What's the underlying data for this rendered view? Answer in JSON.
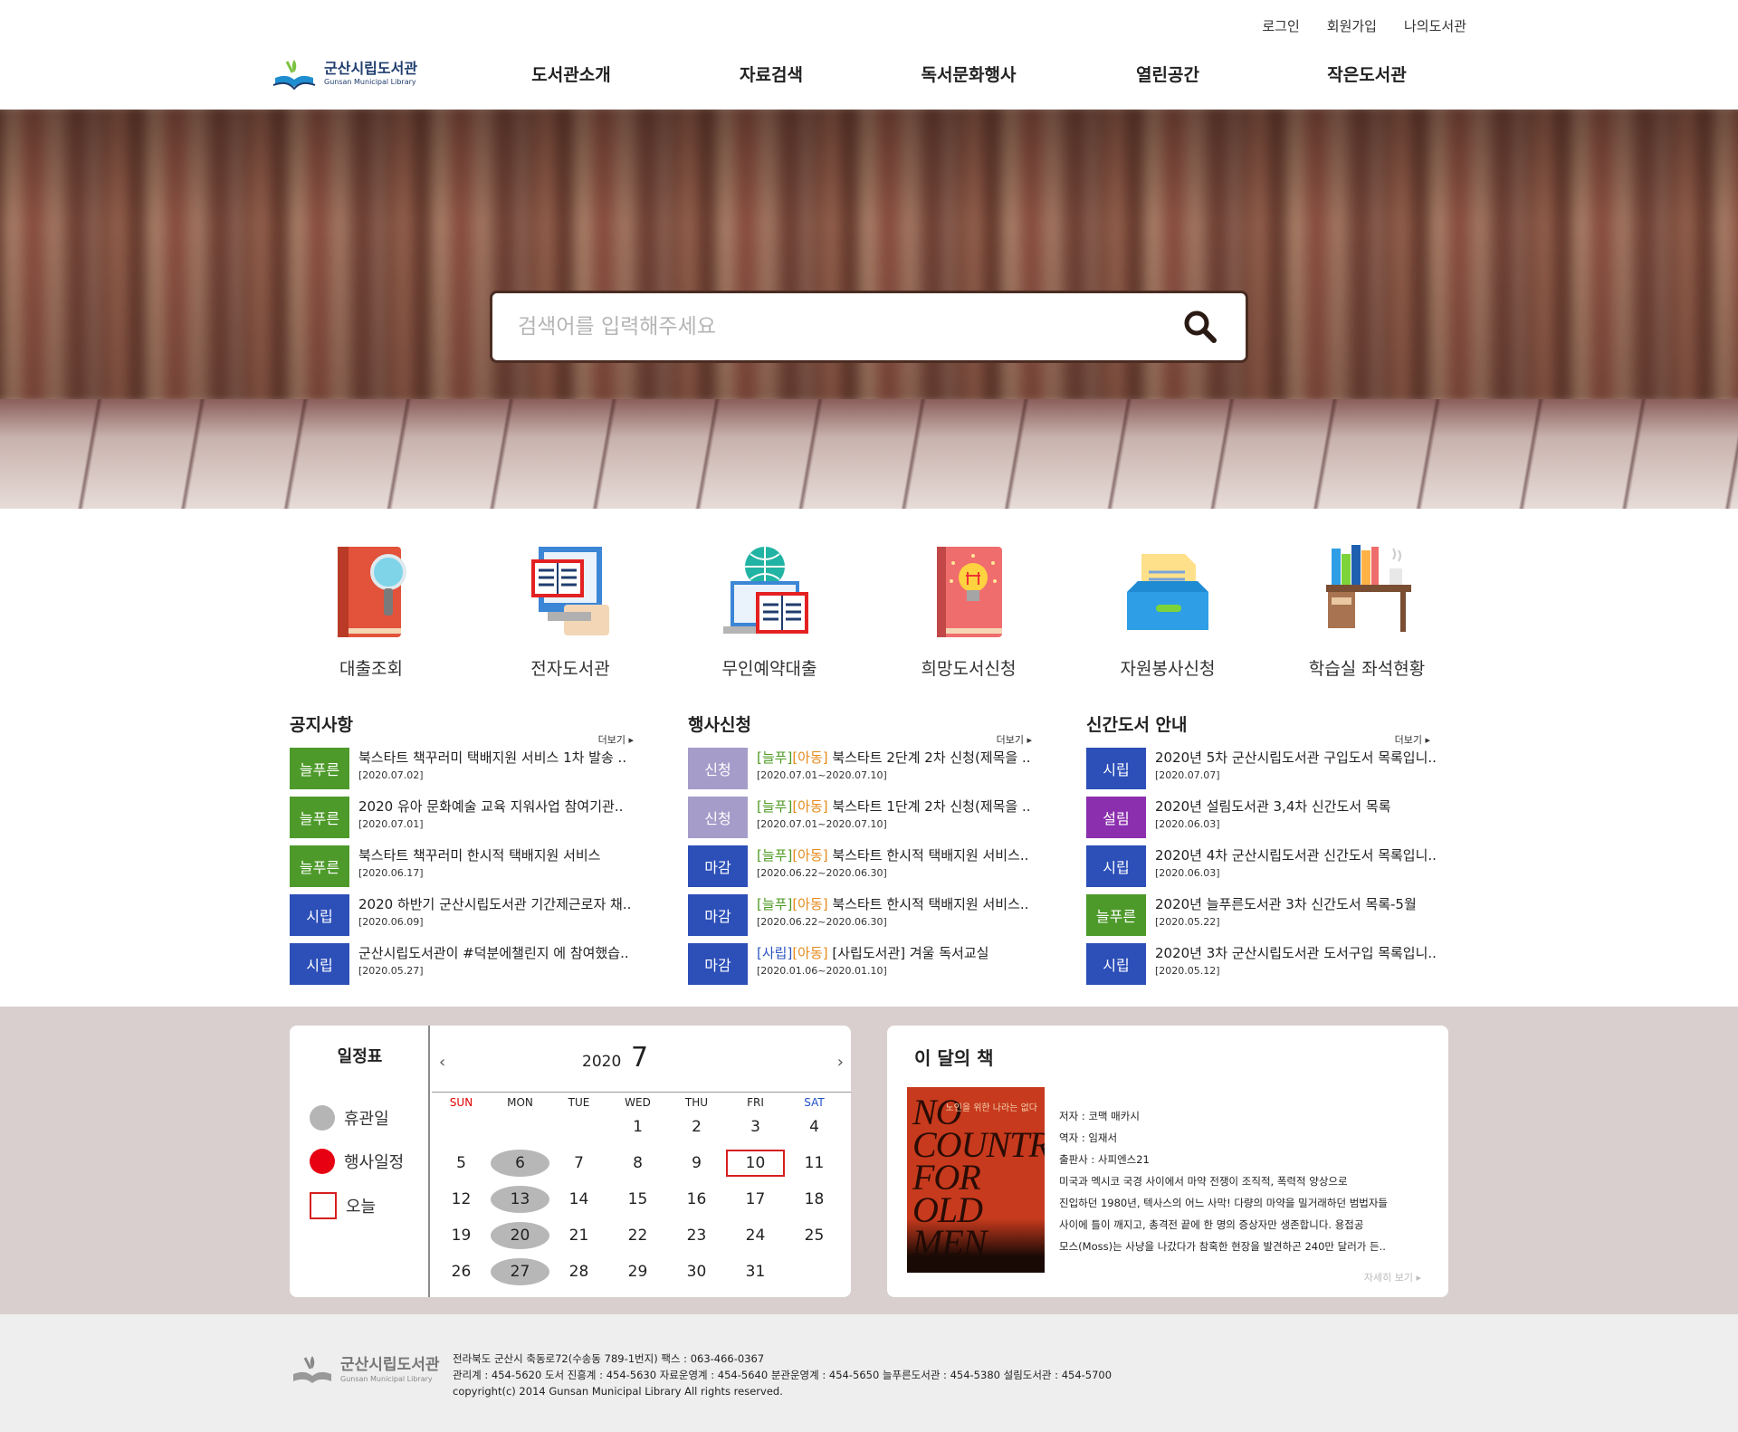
{
  "header": {
    "top_links": [
      "로그인",
      "회원가입",
      "나의도서관"
    ],
    "logo_ko": "군산시립도서관",
    "logo_en": "Gunsan Municipal Library",
    "nav": [
      "도서관소개",
      "자료검색",
      "독서문화행사",
      "열린공간",
      "작은도서관"
    ]
  },
  "search": {
    "placeholder": "검색어를 입력해주세요",
    "icon": "search-icon"
  },
  "quick_menu": [
    {
      "label": "대출조회",
      "icon": "book-magnifier-icon"
    },
    {
      "label": "전자도서관",
      "icon": "e-library-icon"
    },
    {
      "label": "무인예약대출",
      "icon": "globe-laptop-icon"
    },
    {
      "label": "희망도서신청",
      "icon": "lightbulb-book-icon"
    },
    {
      "label": "자원봉사신청",
      "icon": "document-tray-icon"
    },
    {
      "label": "학습실 좌석현황",
      "icon": "desk-books-icon"
    }
  ],
  "boards": {
    "notice": {
      "title": "공지사항",
      "more": "더보기 ▸",
      "items": [
        {
          "tag": "늘푸른",
          "title": "북스타트 책꾸러미 택배지원 서비스 1차 발송 ..",
          "date": "[2020.07.02]"
        },
        {
          "tag": "늘푸른",
          "title": "2020 유아 문화예술 교육 지워사업 참여기관..",
          "date": "[2020.07.01]"
        },
        {
          "tag": "늘푸른",
          "title": "북스타트 책꾸러미 한시적 택배지원 서비스",
          "date": "[2020.06.17]"
        },
        {
          "tag": "시립",
          "title": "2020 하반기 군산시립도서관 기간제근로자 채..",
          "date": "[2020.06.09]"
        },
        {
          "tag": "시립",
          "title": "군산시립도서관이 #덕분에챌린지 에 참여했습..",
          "date": "[2020.05.27]"
        }
      ]
    },
    "events": {
      "title": "행사신청",
      "more": "더보기 ▸",
      "items": [
        {
          "tag": "신청",
          "p1": "[늘푸]",
          "p2": "[아동]",
          "title": " 북스타트 2단계 2차 신청(제목을 ..",
          "date": "[2020.07.01~2020.07.10]"
        },
        {
          "tag": "신청",
          "p1": "[늘푸]",
          "p2": "[아동]",
          "title": " 북스타트 1단계 2차 신청(제목을 ..",
          "date": "[2020.07.01~2020.07.10]"
        },
        {
          "tag": "마감",
          "p1": "[늘푸]",
          "p2": "[아동]",
          "title": " 북스타트 한시적 택배지원 서비스..",
          "date": "[2020.06.22~2020.06.30]"
        },
        {
          "tag": "마감",
          "p1": "[늘푸]",
          "p2": "[아동]",
          "title": " 북스타트 한시적 택배지원 서비스..",
          "date": "[2020.06.22~2020.06.30]"
        },
        {
          "tag": "마감",
          "p1": "[사립]",
          "p2": "[아동]",
          "title": " [사립도서관] 겨울 독서교실",
          "date": "[2020.01.06~2020.01.10]"
        }
      ]
    },
    "new_books": {
      "title": "신간도서 안내",
      "more": "더보기 ▸",
      "items": [
        {
          "tag": "시립",
          "title": "2020년 5차 군산시립도서관 구입도서 목록입니..",
          "date": "[2020.07.07]"
        },
        {
          "tag": "설림",
          "title": "2020년 설림도서관 3,4차 신간도서 목록",
          "date": "[2020.06.03]"
        },
        {
          "tag": "시립",
          "title": "2020년 4차 군산시립도서관 신간도서 목록입니..",
          "date": "[2020.06.03]"
        },
        {
          "tag": "늘푸른",
          "title": "2020년 늘푸른도서관 3차 신간도서 목록-5월",
          "date": "[2020.05.22]"
        },
        {
          "tag": "시립",
          "title": "2020년 3차 군산시립도서관 도서구입 목록입니..",
          "date": "[2020.05.12]"
        }
      ]
    }
  },
  "tag_colors": {
    "늘푸른": "#4d9a2a",
    "시립": "#2c4fb8",
    "설림": "#8b2fae",
    "신청": "#a59cc9",
    "마감": "#2c4fb8"
  },
  "schedule": {
    "title": "일정표",
    "legend": [
      "휴관일",
      "행사일정",
      "오늘"
    ],
    "year": "2020",
    "month": "7",
    "prev": "‹",
    "next": "›",
    "dows": [
      "SUN",
      "MON",
      "TUE",
      "WED",
      "THU",
      "FRI",
      "SAT"
    ],
    "weeks": [
      [
        "",
        "",
        "",
        "1",
        "2",
        "3",
        "4"
      ],
      [
        "5",
        "6",
        "7",
        "8",
        "9",
        "10",
        "11"
      ],
      [
        "12",
        "13",
        "14",
        "15",
        "16",
        "17",
        "18"
      ],
      [
        "19",
        "20",
        "21",
        "22",
        "23",
        "24",
        "25"
      ],
      [
        "26",
        "27",
        "28",
        "29",
        "30",
        "31",
        ""
      ]
    ],
    "holidays": [
      "6",
      "13",
      "20",
      "27"
    ],
    "today": "10"
  },
  "book_of_month": {
    "title": "이 달의 책",
    "cover_title": "NO COUNTRY FOR OLD MEN",
    "cover_sub": "노인을 위한 나라는 없다",
    "author": "저자 : 코맥 매카시",
    "translator": "역자 : 임재서",
    "publisher": "출판사 : 사피엔스21",
    "desc": [
      "미국과 멕시코 국경 사이에서 마약 전쟁이 조직적, 폭력적 양상으로",
      "진입하던 1980년, 텍사스의 어느 사막! 다량의 마약을 밀거래하던 범법자들",
      "사이에 틀이 깨지고, 총격전 끝에 한 명의 증상자만 생존합니다. 용접공",
      "모스(Moss)는 사냥을 나갔다가 참혹한 현장을 발견하곤 240만 달러가 든.."
    ],
    "more": "자세히 보기 ▸"
  },
  "footer": {
    "logo_ko": "군산시립도서관",
    "logo_en": "Gunsan Municipal Library",
    "lines": [
      "전라북도 군산시 축동로72(수송동 789-1번지)   팩스 : 063-466-0367",
      "관리계 : 454-5620   도서 진흥계 : 454-5630   자료운영계 : 454-5640   분관운영계 : 454-5650   늘푸른도서관 : 454-5380   설림도서관 : 454-5700",
      "copyright(c) 2014 Gunsan Municipal Library All rights reserved."
    ]
  }
}
